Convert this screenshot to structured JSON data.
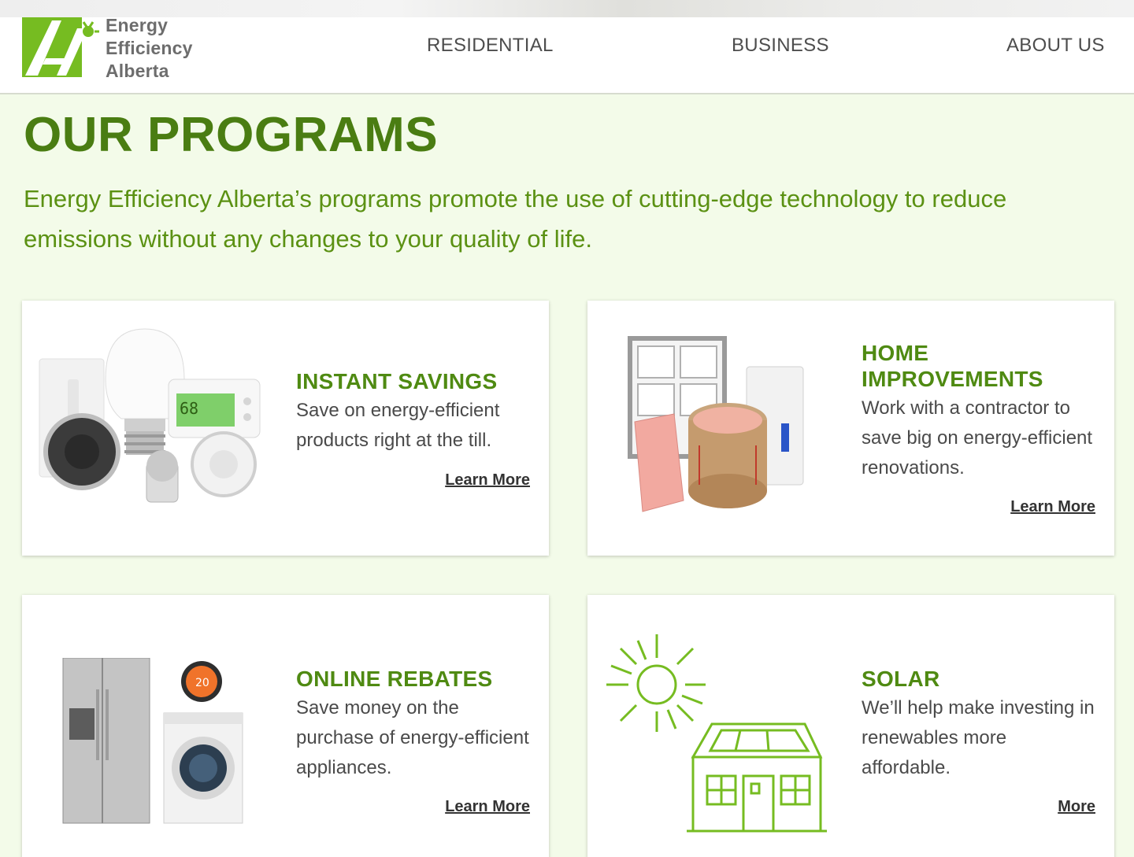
{
  "brand": {
    "name_line1": "Energy",
    "name_line2": "Efficiency",
    "name_line3": "Alberta",
    "primary_color": "#4a7d12",
    "accent_color": "#76bc21"
  },
  "nav": {
    "residential": "RESIDENTIAL",
    "business": "BUSINESS",
    "about": "ABOUT US"
  },
  "main": {
    "title": "OUR PROGRAMS",
    "intro": "Energy Efficiency Alberta’s programs promote the use of cutting-edge technology to reduce emissions without any changes to your quality of life."
  },
  "programs": [
    {
      "title": "INSTANT SAVINGS",
      "description": "Save on energy-efficient products right at the till.",
      "link": "Learn More",
      "image": "products-image"
    },
    {
      "title": "HOME IMPROVEMENTS",
      "description": "Work with a contractor to save big on energy-efficient renovations.",
      "link": "Learn More",
      "image": "window-insulation-image"
    },
    {
      "title": "ONLINE REBATES",
      "description": "Save money on the purchase of energy-efficient appliances.",
      "link": "Learn More",
      "image": "appliances-image"
    },
    {
      "title": "SOLAR",
      "description": "We’ll help make investing in renewables more affordable.",
      "link": "More",
      "image": "solar-house-icon"
    }
  ]
}
